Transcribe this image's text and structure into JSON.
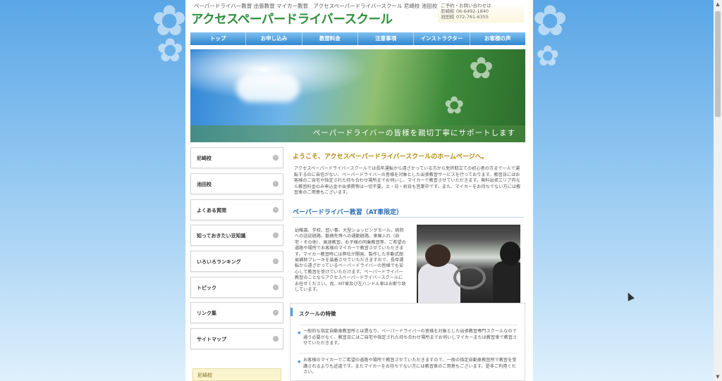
{
  "header": {
    "tagline": "ペーパードライバー教習 出張教習 マイカー教習　アクセスペーパードライバースクール 尼崎校 池田校",
    "site_title": "アクセスペーパードライバースクール",
    "contact_heading": "ご予約・お問い合わせは",
    "contacts": [
      {
        "label": "尼崎校",
        "tel": "06-6492-1840"
      },
      {
        "label": "池田校",
        "tel": "072-761-6355"
      }
    ]
  },
  "nav": [
    "トップ",
    "お申し込み",
    "教習料金",
    "注意事項",
    "インストラクター",
    "お客様の声"
  ],
  "hero": {
    "caption": "ペーパードライバーの皆様を親切丁寧にサポートします"
  },
  "sidebar": {
    "items": [
      "尼崎校",
      "池田校",
      "よくある質問",
      "知っておきたい豆知識",
      "いろいろランキング",
      "トピック",
      "リンク集",
      "サイトマップ"
    ],
    "bottom_label": "尼崎校"
  },
  "main": {
    "welcome": "ようこそ、アクセスペーパードライバースクールのホームページへ。",
    "intro": "アクセスペーパードライバースクールでは長年運転から遠ざかっている方から免許取立ての初心者の方まで一人で運転するのに自信がない、ペーパードライバーの皆様を対象とした出張教習サービスを行っております。教習日にはお客様のご自宅や指定された待ち合わせ場所までお伺いし、マイカーで教習させていただきます。無料出張エリア内なら教習料金のみ申込金や出張費等は一切不要。土・日・祝日も営業中です。また、マイカーをお持ちでない方には教習車のご用意もございます。",
    "section_title": "ペーパードライバー教習（AT車限定）",
    "section_desc": "幼稚園、学校、習い事、大型ショッピングモール、病院への送迎経路、勤務先等への通勤経路、車庫入れ（自宅・その他）、高速教習、お子様の同乗教習等、ご希望の道路や場所でお客様のマイカーで教習させていただきます。マイカー教習時には弊社が開発、製作した手動式簡易補助ブレーキを装着させていただきますので、長年運転から遠ざかっているペーパードライバーの皆様でも安心して教習を受けていただけます。ペーパードライバー教習のことならアクセスペーパードライバースクールにお任せください。尚、MT車及び左ハンドル車はお断り致しています。",
    "features_title": "スクールの特徴",
    "features": [
      "一般的な指定自動車教習所とは異なり、ペーパードライバーの皆様を対象とした出張教習専門スクールなので通う必要がなく、教習日にはご自宅や指定された待ち合わせ場所までお伺いしマイカーまたは教習車で教習させていただきます。",
      "お客様のマイカーでご希望の道路や場所で教習させていただきますので、一般の指定自動車教習所で教習を受講されるよりも近道です。またマイカーをお持ちでない方には教習車のご用意もございます。是非ご利用ください。"
    ]
  }
}
